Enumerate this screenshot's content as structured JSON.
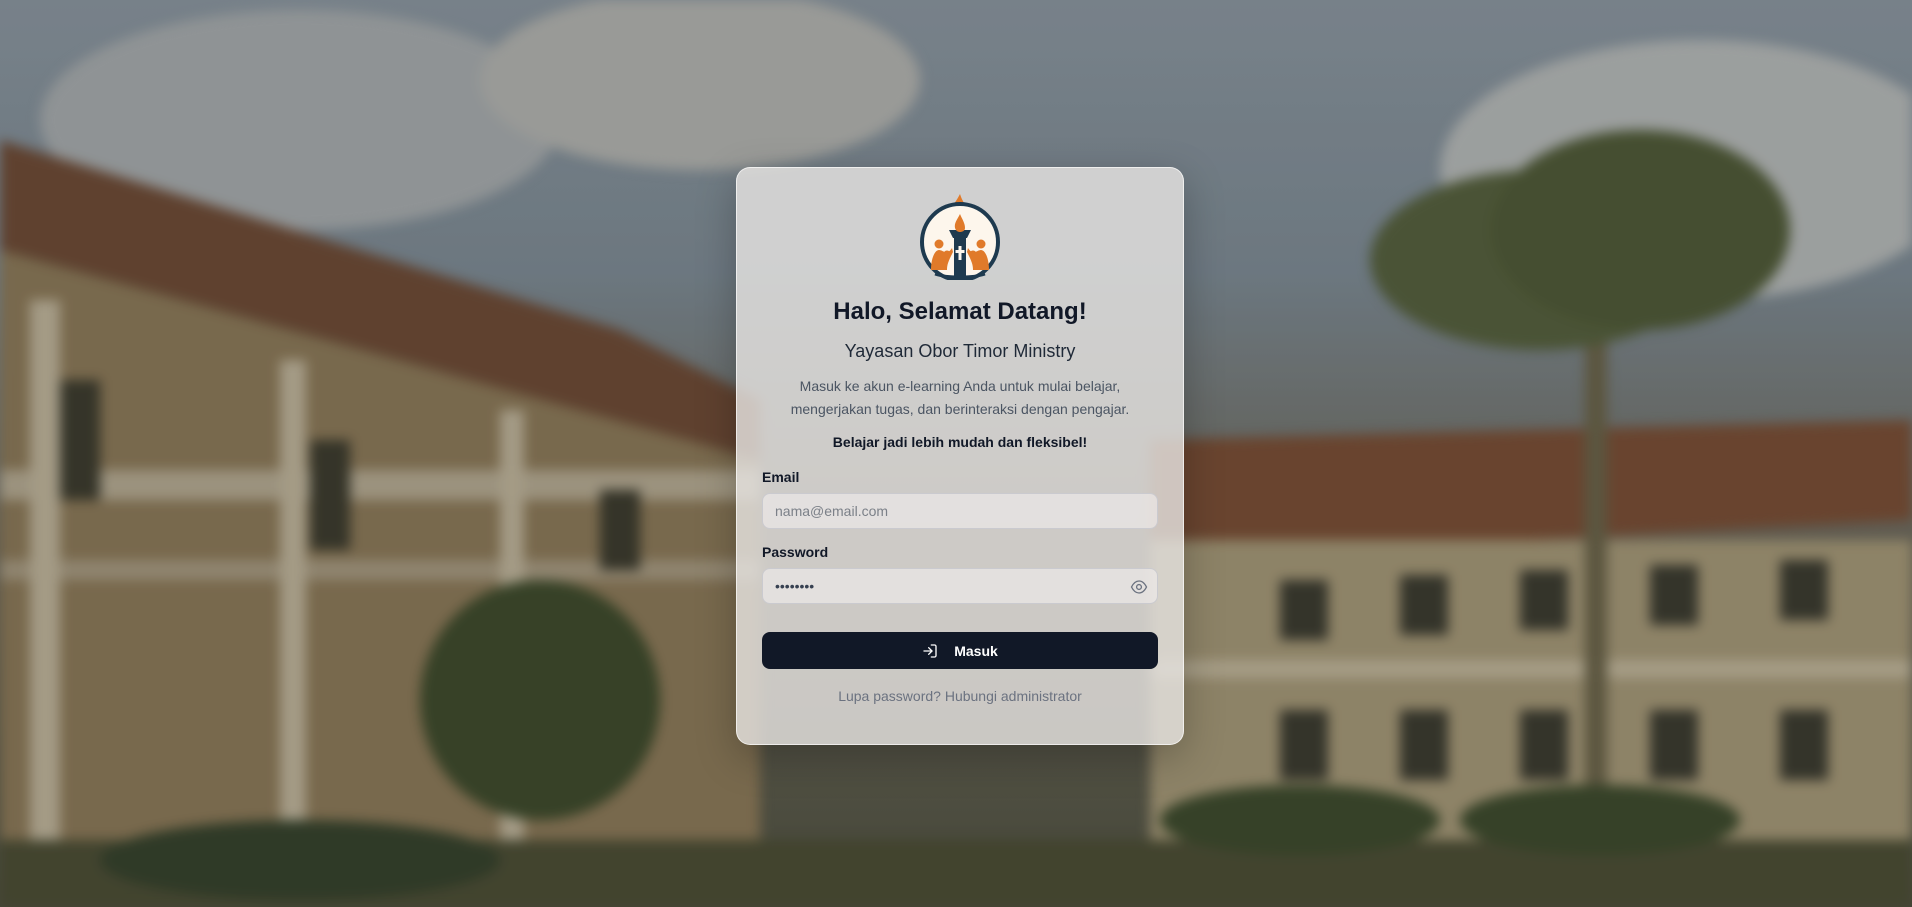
{
  "welcome": {
    "title": "Halo, Selamat Datang!",
    "org_name": "Yayasan Obor Timor Ministry",
    "description": "Masuk ke akun e-learning Anda untuk mulai belajar, mengerjakan tugas, dan berinteraksi dengan pengajar.",
    "tagline": "Belajar jadi lebih mudah dan fleksibel!"
  },
  "form": {
    "email_label": "Email",
    "email_placeholder": "nama@email.com",
    "email_value": "",
    "password_label": "Password",
    "password_value": "password",
    "password_toggle_icon": "eye-icon",
    "submit_label": "Masuk",
    "submit_icon": "login-arrow-icon"
  },
  "footer": {
    "forgot_text": "Lupa password? Hubungi administrator"
  },
  "colors": {
    "primary_button": "#111827",
    "logo_navy": "#1e3a4f",
    "logo_orange": "#e07a2a",
    "text_dark": "#111827",
    "text_muted": "#6b7280"
  }
}
